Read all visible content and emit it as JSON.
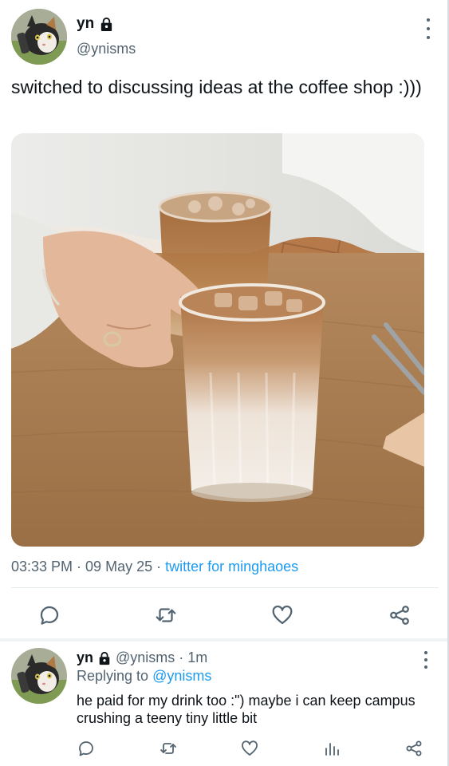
{
  "tweet": {
    "author_name": "yn",
    "handle": "@ynisms",
    "text": "switched to discussing ideas at the coffee shop :)))",
    "time": "03:33 PM",
    "sep1": " · ",
    "date": "09 May 25",
    "sep2": " · ",
    "source": "twitter for minghaoes",
    "media_icon": "iced-latte-photo"
  },
  "reply": {
    "author_name": "yn",
    "handle": "@ynisms",
    "sep": "·",
    "age": "1m",
    "replying_prefix": "Replying to",
    "replying_to": "@ynisms",
    "text": "he paid for my drink too :\") maybe i can keep campus crushing a teeny tiny little bit"
  },
  "icons": {
    "lock": "lock-icon",
    "more": "more-vertical-icon",
    "reply": "reply-icon",
    "retweet": "retweet-icon",
    "like": "heart-icon",
    "share": "share-icon",
    "views": "views-icon"
  },
  "colors": {
    "text": "#0f1419",
    "muted": "#536471",
    "link": "#1d9bf0",
    "divider": "#e6ebee"
  }
}
